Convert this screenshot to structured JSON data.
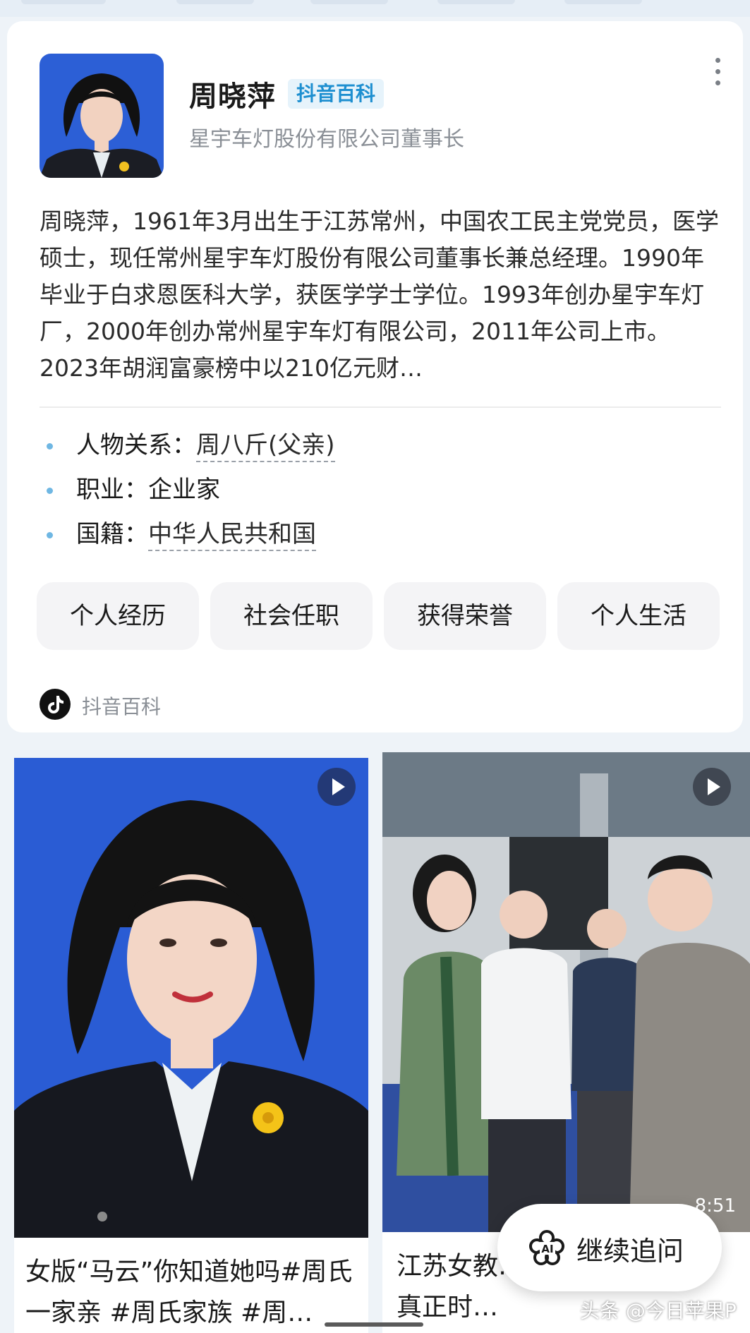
{
  "profile": {
    "name": "周晓萍",
    "badge": "抖音百科",
    "subtitle": "星宇车灯股份有限公司董事长",
    "summary": "周晓萍，1961年3月出生于江苏常州，中国农工民主党党员，医学硕士，现任常州星宇车灯股份有限公司董事长兼总经理。1990年毕业于白求恩医科大学，获医学学士学位。1993年创办星宇车灯厂，2000年创办常州星宇车灯有限公司，2011年公司上市。2023年胡润富豪榜中以210亿元财…"
  },
  "facts": [
    {
      "label": "人物关系：",
      "value": "周八斤(父亲)"
    },
    {
      "label": "职业：",
      "value": "企业家"
    },
    {
      "label": "国籍：",
      "value": "中华人民共和国"
    }
  ],
  "tabs": [
    "个人经历",
    "社会任职",
    "获得荣誉",
    "个人生活"
  ],
  "source": {
    "label": "抖音百科"
  },
  "videos": [
    {
      "caption": "女版“马云”你知道她吗#周氏一家亲 #周氏家族 #周…"
    },
    {
      "caption": "江苏女教…坊干到中国第一：真正时…",
      "duration": "8:51"
    }
  ],
  "ask_button": {
    "label": "继续追问",
    "icon": "ai-icon"
  },
  "watermark": "头条 @今日苹果P",
  "colors": {
    "accent": "#1e8fd0",
    "badge_bg": "#e6f3fb",
    "bullet": "#6fb7e3"
  }
}
